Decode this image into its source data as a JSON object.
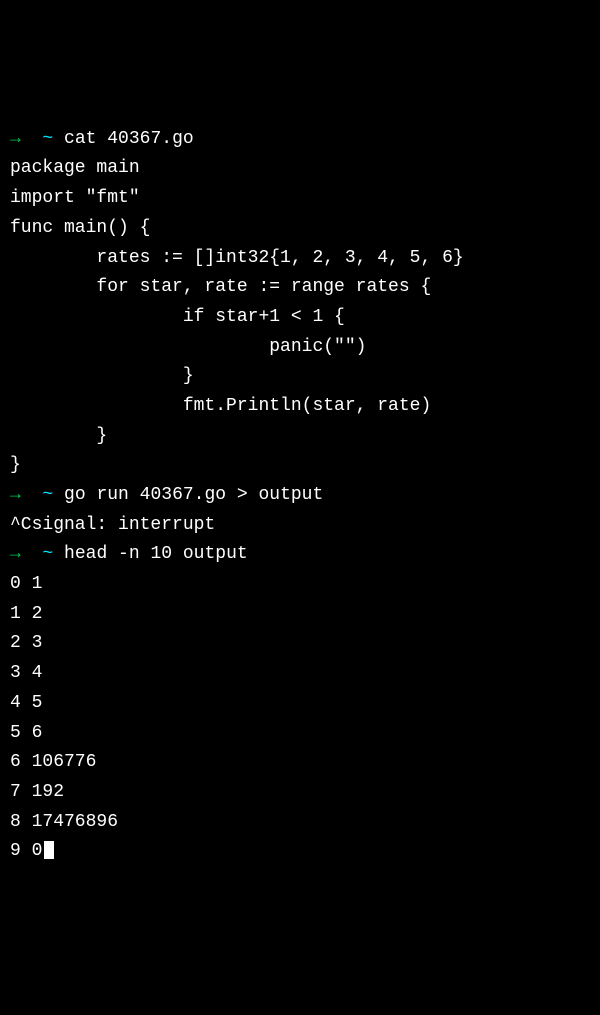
{
  "prompts": {
    "arrow": "→",
    "tilde": "~",
    "cat_cmd": "cat 40367.go",
    "run_cmd": "go run 40367.go > output",
    "head_cmd": "head -n 10 output"
  },
  "source_code": {
    "l1": "package main",
    "l2": "",
    "l3": "import \"fmt\"",
    "l4": "",
    "l5": "func main() {",
    "l6": "        rates := []int32{1, 2, 3, 4, 5, 6}",
    "l7": "        for star, rate := range rates {",
    "l8": "                if star+1 < 1 {",
    "l9": "                        panic(\"\")",
    "l10": "                }",
    "l11": "                fmt.Println(star, rate)",
    "l12": "        }",
    "l13": "}"
  },
  "interrupt": "^Csignal: interrupt",
  "output_lines": {
    "o1": "0 1",
    "o2": "1 2",
    "o3": "2 3",
    "o4": "3 4",
    "o5": "4 5",
    "o6": "5 6",
    "o7": "6 106776",
    "o8": "7 192",
    "o9": "8 17476896",
    "o10": "9 0"
  }
}
